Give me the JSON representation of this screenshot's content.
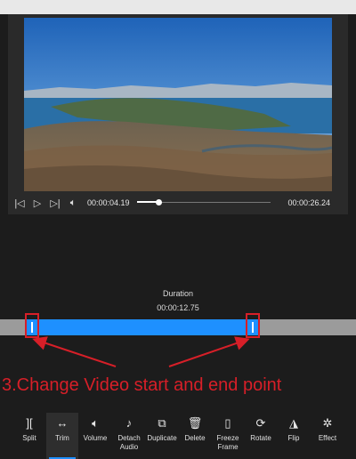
{
  "player": {
    "current_time": "00:00:04.19",
    "total_time": "00:00:26.24",
    "progress_fraction": 0.16,
    "icons": {
      "previous": "skip-back-icon",
      "play": "play-icon",
      "next": "skip-forward-icon",
      "volume": "volume-icon"
    }
  },
  "trim": {
    "duration_label": "Duration",
    "duration_value": "00:00:12.75",
    "start_fraction": 0.16,
    "end_fraction": 0.65
  },
  "annotation": {
    "text": "3.Change Video start and end point",
    "color": "#d71f28"
  },
  "toolbar": {
    "active_tool": "Trim",
    "tools": [
      {
        "label": "Split",
        "icon": "split-icon"
      },
      {
        "label": "Trim",
        "icon": "trim-icon"
      },
      {
        "label": "Volume",
        "icon": "volume-icon"
      },
      {
        "label": "Detach Audio",
        "icon": "detach-audio-icon"
      },
      {
        "label": "Duplicate",
        "icon": "duplicate-icon"
      },
      {
        "label": "Delete",
        "icon": "delete-icon"
      },
      {
        "label": "Freeze Frame",
        "icon": "freeze-frame-icon"
      },
      {
        "label": "Rotate",
        "icon": "rotate-icon"
      },
      {
        "label": "Flip",
        "icon": "flip-icon"
      },
      {
        "label": "Effect",
        "icon": "effect-icon"
      }
    ]
  },
  "colors": {
    "accent": "#1e90ff",
    "annotation": "#d71f28",
    "background": "#1c1c1c"
  }
}
